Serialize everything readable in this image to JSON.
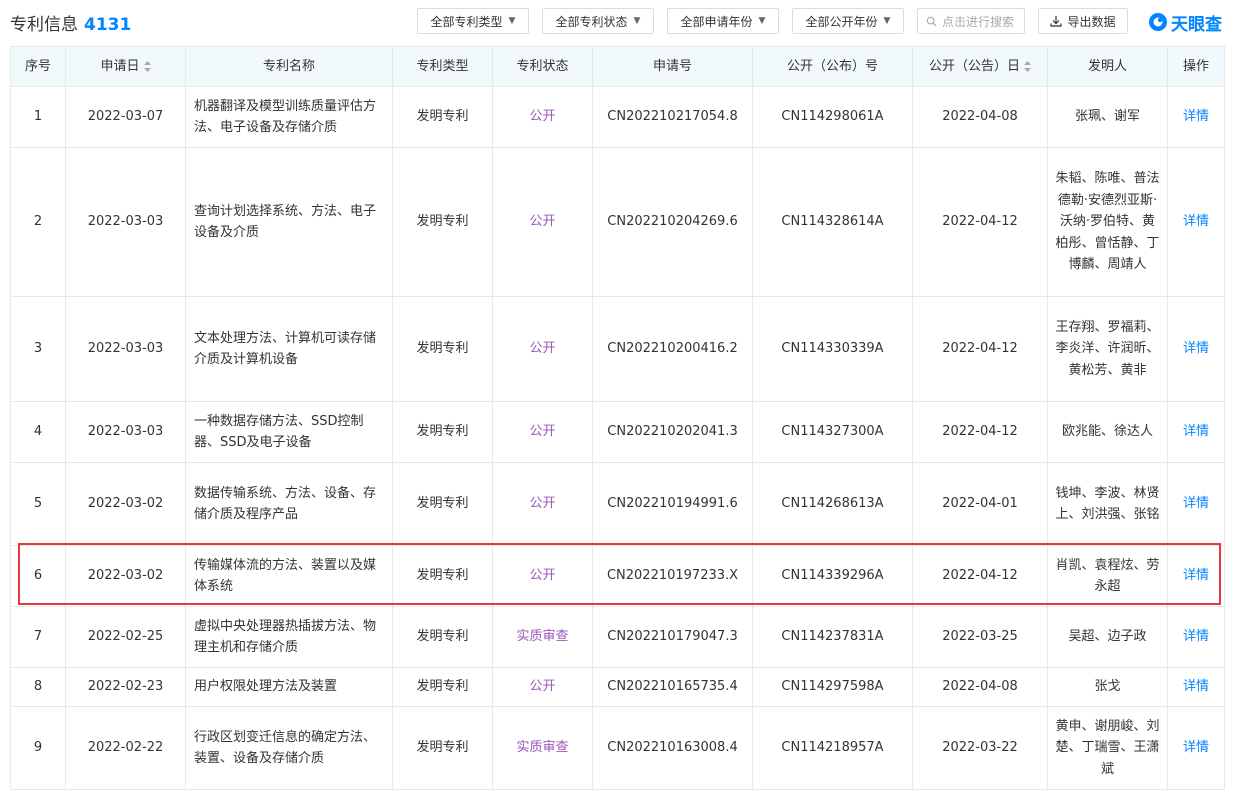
{
  "header": {
    "title": "专利信息",
    "count": "4131",
    "filters": {
      "type": "全部专利类型",
      "status": "全部专利状态",
      "apply_year": "全部申请年份",
      "publish_year": "全部公开年份"
    },
    "search_placeholder": "点击进行搜索",
    "export_label": "导出数据",
    "logo_text": "天眼查"
  },
  "table": {
    "columns": {
      "index": "序号",
      "apply_date": "申请日",
      "name": "专利名称",
      "type": "专利类型",
      "status": "专利状态",
      "apply_no": "申请号",
      "pub_no": "公开（公布）号",
      "pub_date": "公开（公告）日",
      "inventors": "发明人",
      "action": "操作"
    },
    "rows": [
      {
        "index": "1",
        "apply_date": "2022-03-07",
        "name": "机器翻译及模型训练质量评估方法、电子设备及存储介质",
        "type": "发明专利",
        "status": "公开",
        "apply_no": "CN202210217054.8",
        "pub_no": "CN114298061A",
        "pub_date": "2022-04-08",
        "inventors": "张珮、谢军",
        "action": "详情"
      },
      {
        "index": "2",
        "apply_date": "2022-03-03",
        "name": "查询计划选择系统、方法、电子设备及介质",
        "type": "发明专利",
        "status": "公开",
        "apply_no": "CN202210204269.6",
        "pub_no": "CN114328614A",
        "pub_date": "2022-04-12",
        "inventors": "朱韬、陈唯、普法德勒·安德烈亚斯·沃纳·罗伯特、黄柏彤、曾恬静、丁博麟、周靖人",
        "action": "详情"
      },
      {
        "index": "3",
        "apply_date": "2022-03-03",
        "name": "文本处理方法、计算机可读存储介质及计算机设备",
        "type": "发明专利",
        "status": "公开",
        "apply_no": "CN202210200416.2",
        "pub_no": "CN114330339A",
        "pub_date": "2022-04-12",
        "inventors": "王存翔、罗福莉、李炎洋、许润昕、黄松芳、黄非",
        "action": "详情"
      },
      {
        "index": "4",
        "apply_date": "2022-03-03",
        "name": "一种数据存储方法、SSD控制器、SSD及电子设备",
        "type": "发明专利",
        "status": "公开",
        "apply_no": "CN202210202041.3",
        "pub_no": "CN114327300A",
        "pub_date": "2022-04-12",
        "inventors": "欧兆能、徐达人",
        "action": "详情"
      },
      {
        "index": "5",
        "apply_date": "2022-03-02",
        "name": "数据传输系统、方法、设备、存储介质及程序产品",
        "type": "发明专利",
        "status": "公开",
        "apply_no": "CN202210194991.6",
        "pub_no": "CN114268613A",
        "pub_date": "2022-04-01",
        "inventors": "钱坤、李波、林贤上、刘洪强、张铭",
        "action": "详情"
      },
      {
        "index": "6",
        "apply_date": "2022-03-02",
        "name": "传输媒体流的方法、装置以及媒体系统",
        "type": "发明专利",
        "status": "公开",
        "apply_no": "CN202210197233.X",
        "pub_no": "CN114339296A",
        "pub_date": "2022-04-12",
        "inventors": "肖凯、袁程炫、劳永超",
        "action": "详情"
      },
      {
        "index": "7",
        "apply_date": "2022-02-25",
        "name": "虚拟中央处理器热插拔方法、物理主机和存储介质",
        "type": "发明专利",
        "status": "实质审查",
        "apply_no": "CN202210179047.3",
        "pub_no": "CN114237831A",
        "pub_date": "2022-03-25",
        "inventors": "吴超、边子政",
        "action": "详情"
      },
      {
        "index": "8",
        "apply_date": "2022-02-23",
        "name": "用户权限处理方法及装置",
        "type": "发明专利",
        "status": "公开",
        "apply_no": "CN202210165735.4",
        "pub_no": "CN114297598A",
        "pub_date": "2022-04-08",
        "inventors": "张戈",
        "action": "详情"
      },
      {
        "index": "9",
        "apply_date": "2022-02-22",
        "name": "行政区划变迁信息的确定方法、装置、设备及存储介质",
        "type": "发明专利",
        "status": "实质审查",
        "apply_no": "CN202210163008.4",
        "pub_no": "CN114218957A",
        "pub_date": "2022-03-22",
        "inventors": "黄申、谢朋峻、刘楚、丁瑞雪、王潇斌",
        "action": "详情"
      }
    ]
  }
}
